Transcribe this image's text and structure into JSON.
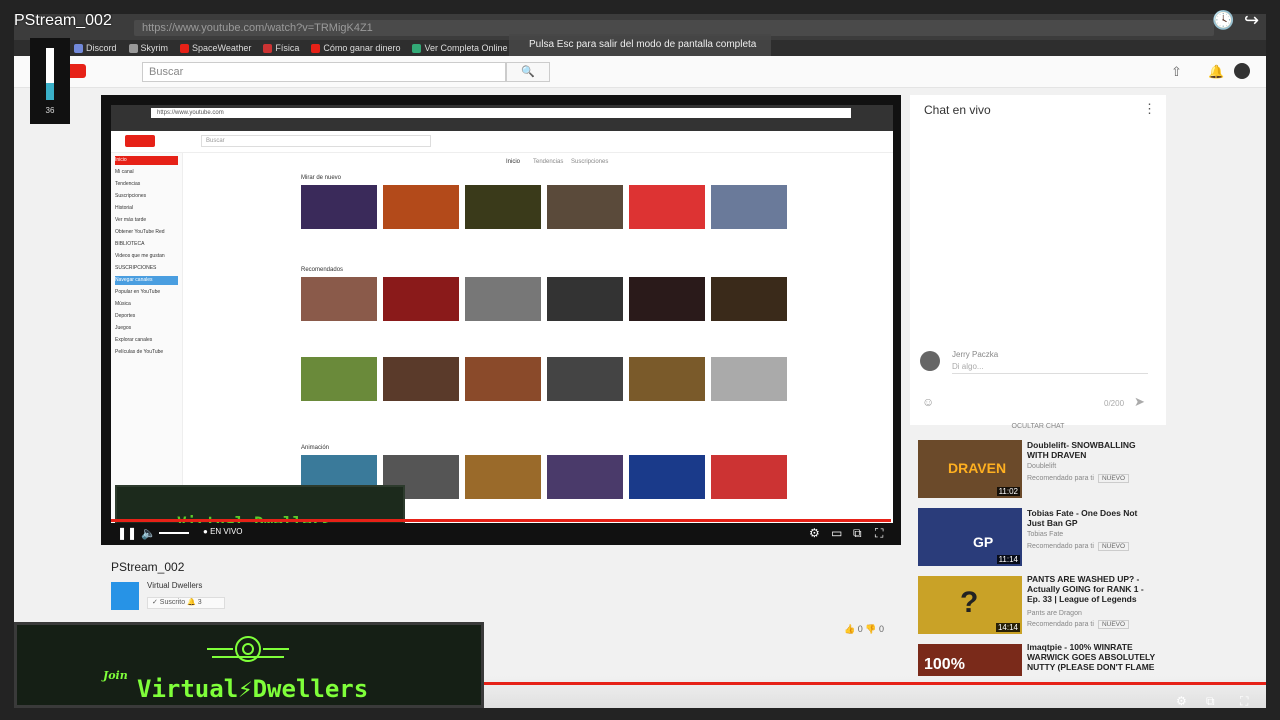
{
  "stream_title": "PStream_002",
  "meter_value": "36",
  "url": "https://www.youtube.com/watch?v=TRMigK4Z1",
  "tooltip": "Pulsa  Esc  para salir del modo de pantalla completa",
  "bookmarks": [
    "Discord",
    "Skyrim",
    "SpaceWeather",
    "Física",
    "Cómo ganar dinero",
    "Ver Completa Online"
  ],
  "masthead": {
    "search_placeholder": "Buscar",
    "search_button": "🔍"
  },
  "player": {
    "inner_url": "https://www.youtube.com",
    "inner_search": "Buscar",
    "tabs": [
      "Inicio",
      "Tendencias",
      "Suscripciones"
    ],
    "sidebar": [
      "Inicio",
      "Mi canal",
      "Tendencias",
      "Suscripciones",
      "Historial",
      "Ver más tarde",
      "Obtener YouTube Red",
      "BIBLIOTECA",
      "Videos que me gustan",
      "SUSCRIPCIONES",
      "Navegar canales",
      "Popular en YouTube",
      "Música",
      "Deportes",
      "Juegos",
      "Explorar canales",
      "Películas de YouTube"
    ],
    "sections": [
      "Mirar de nuevo",
      "Recomendados",
      "Animación"
    ],
    "live_label": "EN VIVO",
    "brand_small": "Virtual Dwellers"
  },
  "chat": {
    "title": "Chat en vivo",
    "user": "Jerry Paczka",
    "placeholder": "Di algo...",
    "count": "0/200",
    "hide": "OCULTAR CHAT"
  },
  "related": [
    {
      "title": "Doublelift- SNOWBALLING WITH DRAVEN",
      "channel": "Doublelift",
      "meta": "Recomendado para ti",
      "badge": "NUEVO",
      "duration": "11:02",
      "thumb_text": "DRAVEN",
      "color": "#6b4a2a"
    },
    {
      "title": "Tobias Fate - One Does Not Just Ban GP",
      "channel": "Tobias Fate",
      "meta": "Recomendado para ti",
      "badge": "NUEVO",
      "duration": "11:14",
      "thumb_text": "GP",
      "color": "#2a3c7a"
    },
    {
      "title": "PANTS ARE WASHED UP? - Actually GOING for RANK 1 - Ep. 33 | League of Legends",
      "channel": "Pants are Dragon",
      "meta": "Recomendado para ti",
      "badge": "NUEVO",
      "duration": "14:14",
      "thumb_text": "?",
      "color": "#c9a227"
    },
    {
      "title": "Imaqtpie - 100% WINRATE WARWICK GOES ABSOLUTELY NUTTY (PLEASE DON'T FLAME",
      "channel": "",
      "meta": "",
      "badge": "",
      "duration": "",
      "thumb_text": "100%",
      "color": "#7a2a1a"
    }
  ],
  "video": {
    "title": "PStream_002",
    "channel": "Virtual Dwellers",
    "subscribe": "✓ Suscrito",
    "sub_count": "3",
    "likes": "0",
    "dislikes": "0"
  },
  "overlay": {
    "join": "Join",
    "brand": "Virtual⚡Dwellers"
  },
  "colors": {
    "accent": "#e62117",
    "brand_green": "#7fff3a"
  }
}
